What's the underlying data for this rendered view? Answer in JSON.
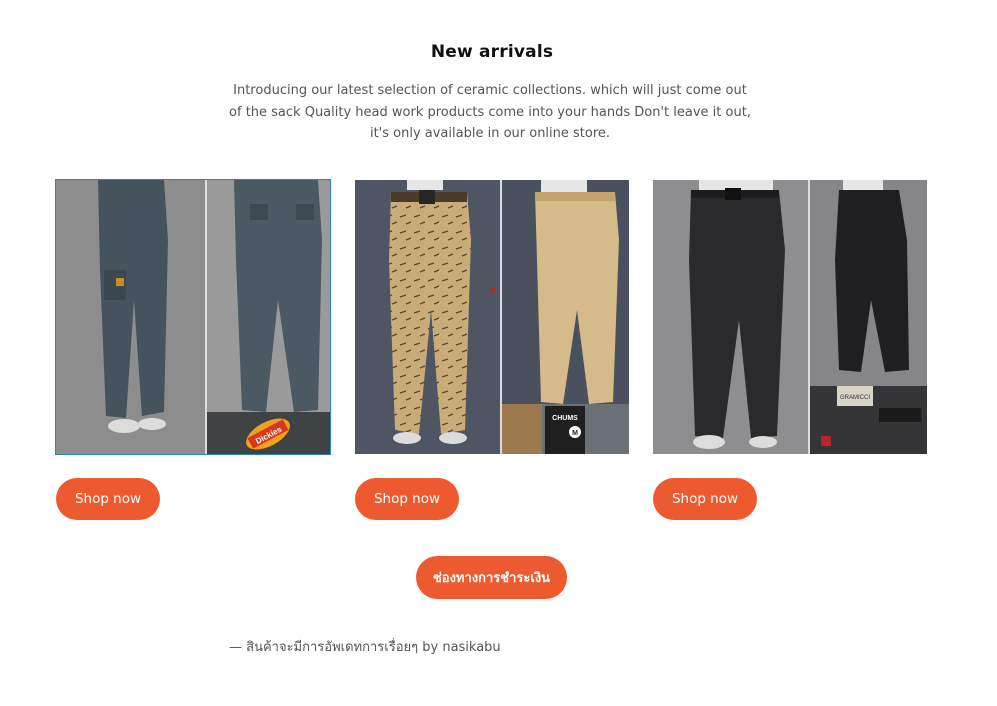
{
  "section": {
    "title": "New arrivals",
    "intro": "Introducing our latest selection of ceramic collections. which will just come out of the sack Quality head work products come into your hands Don't leave it out, it's only available in our online store."
  },
  "products": [
    {
      "image": "blue-grey-cargo-pants-photo",
      "logo_text": "Dickies",
      "shop_label": "Shop now"
    },
    {
      "image": "tan-patterned-pants-photo",
      "tag_text": "CHUMS",
      "tag_size": "M",
      "shop_label": "Shop now"
    },
    {
      "image": "black-pants-photo",
      "tag_text": "GRAMICCI",
      "shop_label": "Shop now"
    }
  ],
  "payment_button": "ช่องทางการชำระเงิน",
  "credit": {
    "dash": "—",
    "text": "สินค้าจะมีการอัพเดทการเรื่อยๆ",
    "by": "by nasikabu"
  },
  "colors": {
    "accent": "#ee5a30",
    "card_outline": "#2a88a8"
  }
}
